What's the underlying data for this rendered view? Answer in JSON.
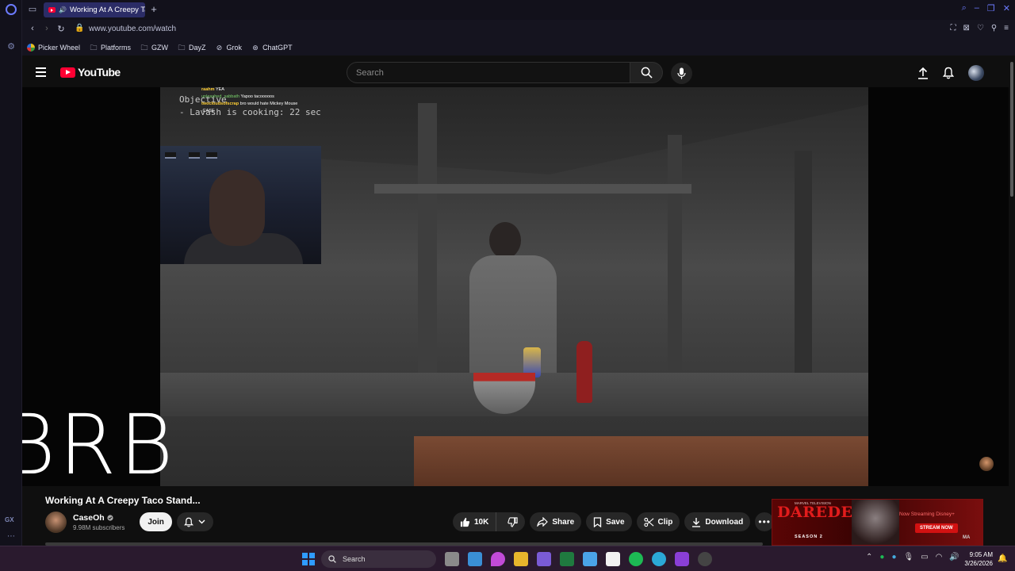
{
  "browser": {
    "tab_title": "Working At A Creepy Ta",
    "url": "www.youtube.com/watch",
    "sidebar_label": "GX",
    "bookmarks": [
      {
        "label": "Picker Wheel",
        "icon": "wheel-icon"
      },
      {
        "label": "Platforms",
        "icon": "folder-icon"
      },
      {
        "label": "GZW",
        "icon": "folder-icon"
      },
      {
        "label": "DayZ",
        "icon": "folder-icon"
      },
      {
        "label": "Grok",
        "icon": "grok-icon"
      },
      {
        "label": "ChatGPT",
        "icon": "chatgpt-icon"
      }
    ]
  },
  "youtube": {
    "logo_text": "YouTube",
    "search_placeholder": "Search",
    "video": {
      "objective_title": "Objective",
      "objective_line": "- Lavash is cooking: 22 sec",
      "chat": [
        {
          "user": "raahm",
          "msg": "YEA"
        },
        {
          "user": "unleashed_sabbath",
          "msg": "Yapoo tacooooos"
        },
        {
          "user": "twocloudsofscrap",
          "msg": "bro would hate Mickey Mouse"
        },
        {
          "user": "",
          "msg": "CASE"
        }
      ],
      "overlay_text": "BRB",
      "title": "Working At A Creepy Taco Stand..."
    },
    "channel": {
      "name": "CaseOh",
      "subscribers": "9.98M subscribers",
      "join_label": "Join"
    },
    "actions": {
      "likes": "10K",
      "share": "Share",
      "save": "Save",
      "clip": "Clip",
      "download": "Download"
    },
    "ad": {
      "title": "DAREDEVIL",
      "brand": "MARVEL TELEVISION",
      "season": "SEASON 2",
      "tagline": "Now Streaming Disney+",
      "cta": "STREAM NOW",
      "rating": "MA"
    }
  },
  "taskbar": {
    "search_placeholder": "Search",
    "time": "9:05 AM",
    "date": "3/26/2026"
  },
  "colors": {
    "youtube_red": "#ff0033",
    "opera_accent": "#6c7bff",
    "taskbar_bg": "#2a1a2e"
  }
}
